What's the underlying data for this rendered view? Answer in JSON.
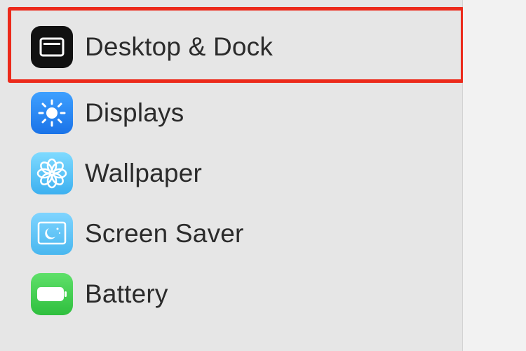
{
  "sidebar": {
    "items": [
      {
        "label": "Desktop & Dock",
        "icon": "desktop-dock-icon",
        "selected": true
      },
      {
        "label": "Displays",
        "icon": "sun-icon"
      },
      {
        "label": "Wallpaper",
        "icon": "flower-icon"
      },
      {
        "label": "Screen Saver",
        "icon": "screen-saver-icon"
      },
      {
        "label": "Battery",
        "icon": "battery-icon"
      }
    ]
  },
  "colors": {
    "highlight_border": "#ec2a1b",
    "sidebar_bg": "#e6e6e6",
    "displays_icon": "#1a73e8",
    "wallpaper_icon": "#3cb0f0",
    "screen_saver_icon": "#49b7ef",
    "battery_icon": "#2fbf3e"
  }
}
